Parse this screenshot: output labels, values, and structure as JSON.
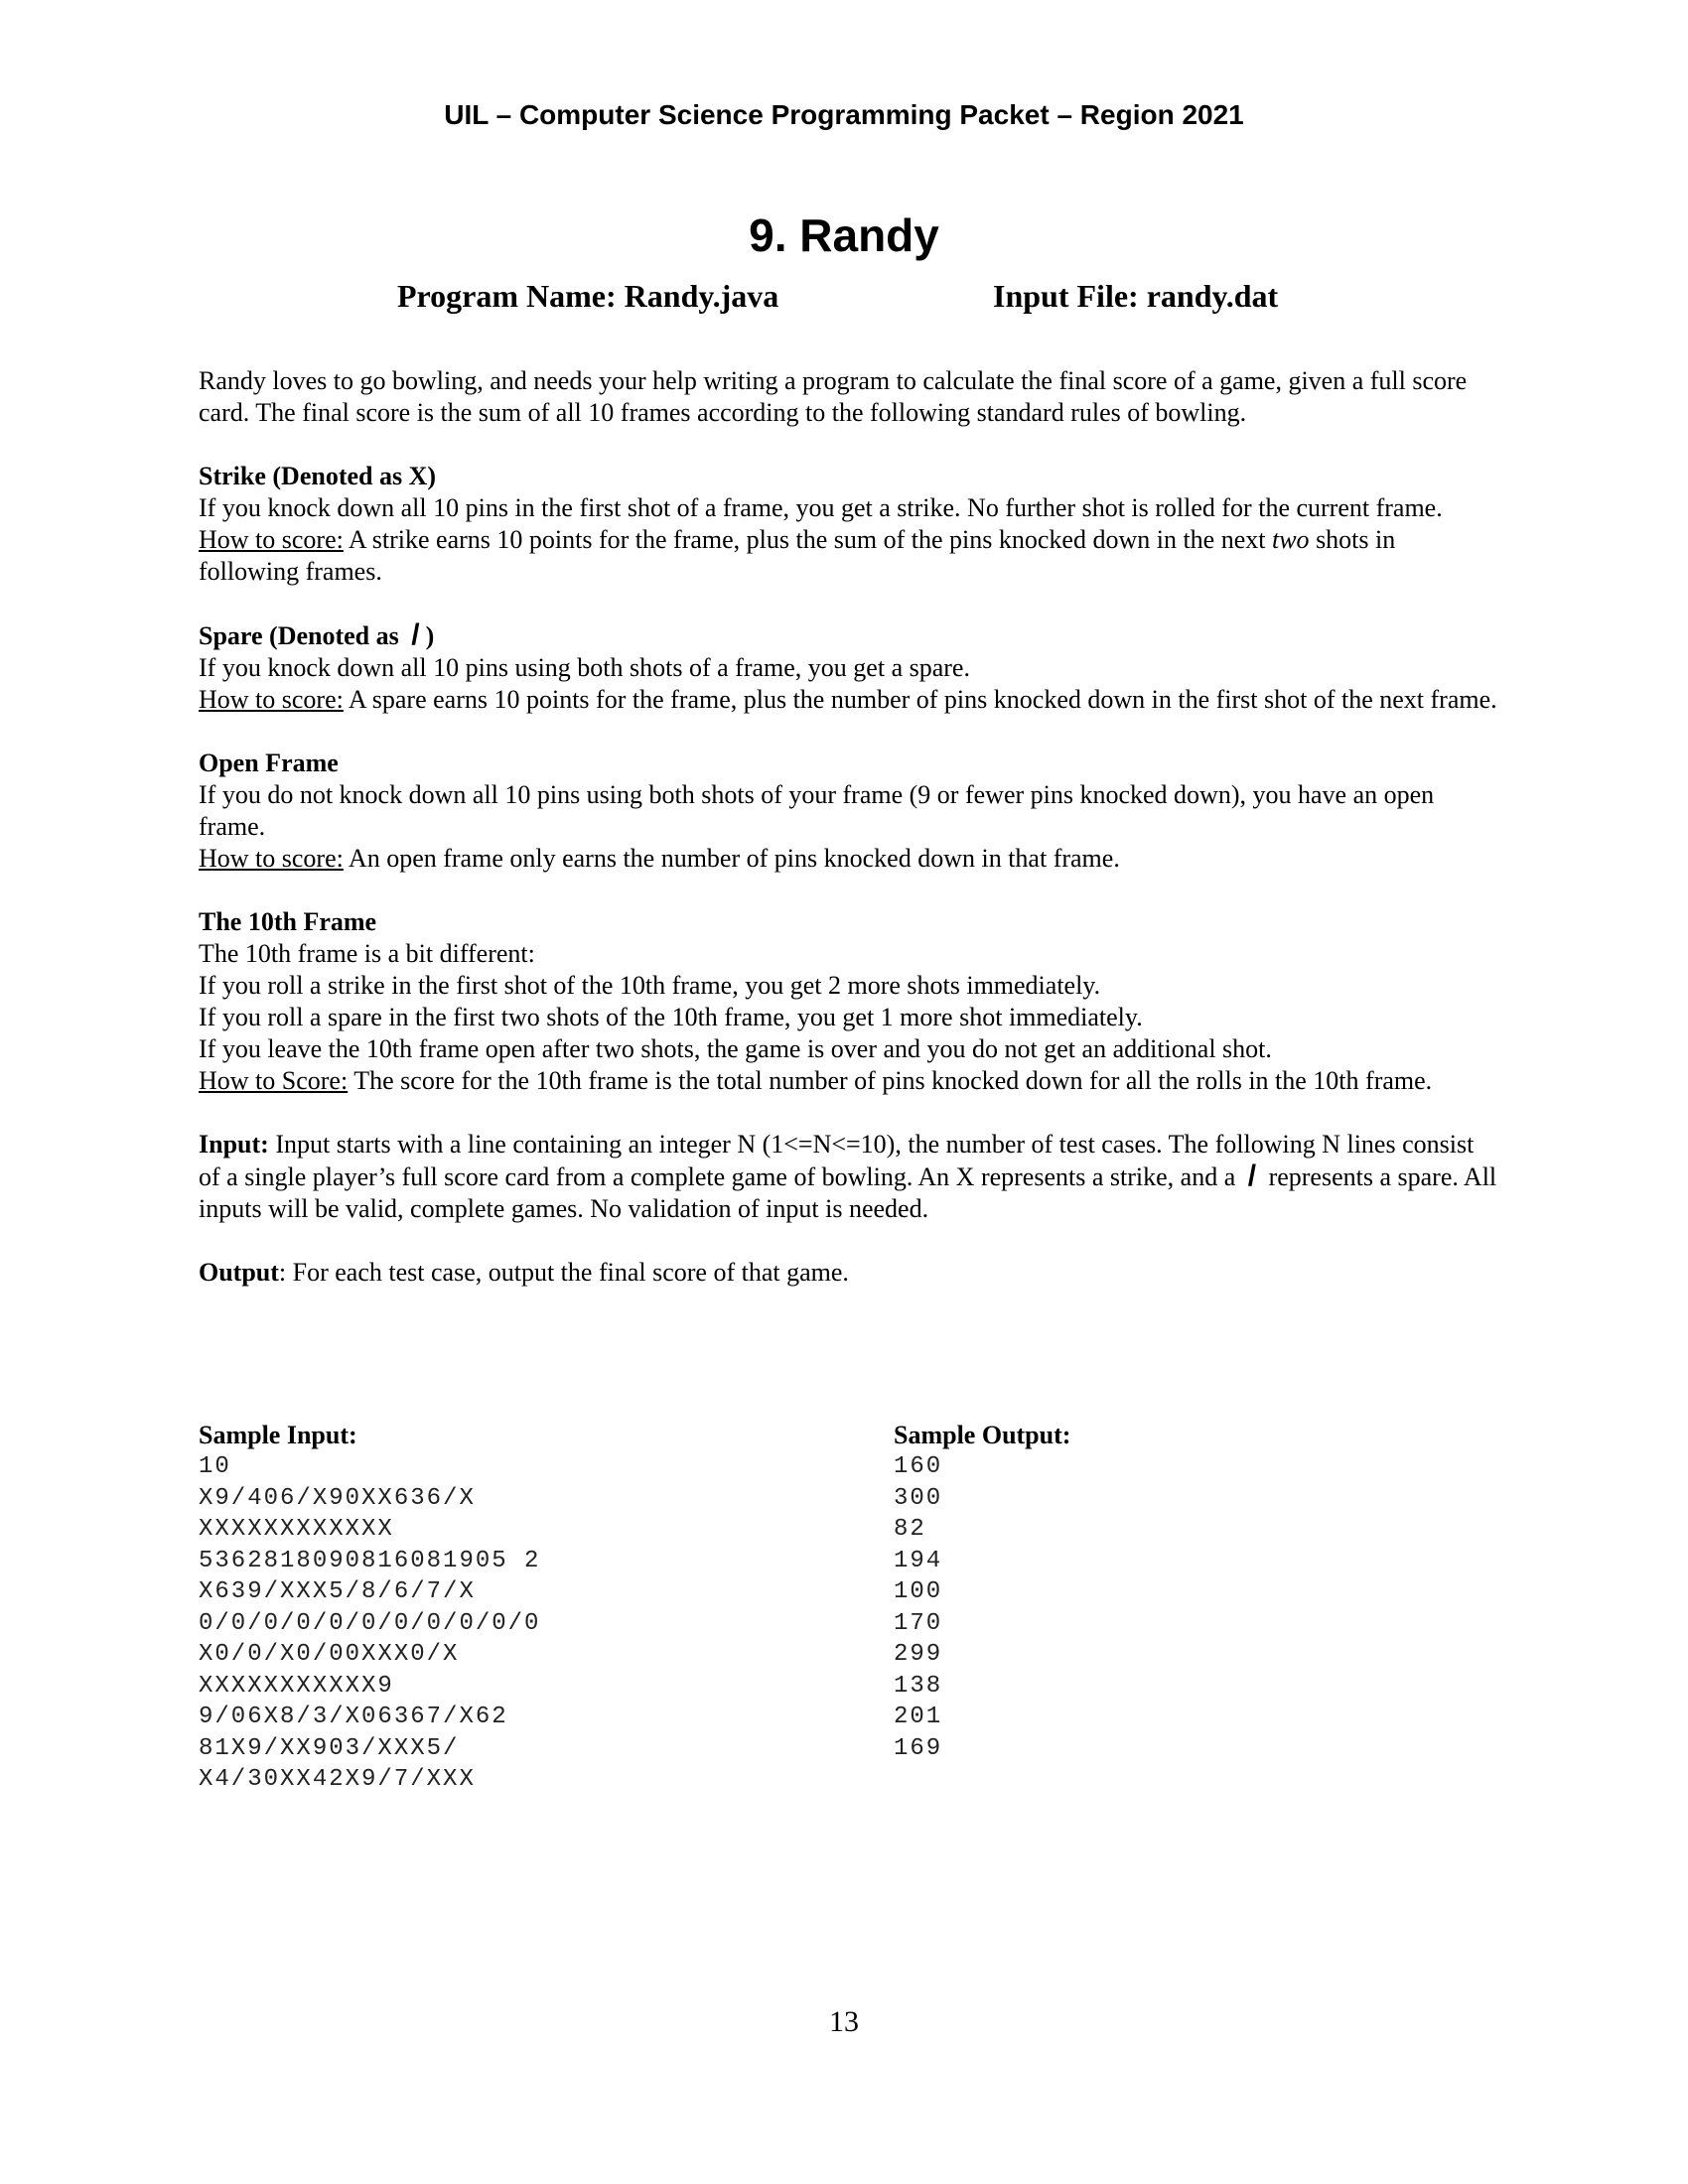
{
  "header": "UIL – Computer Science Programming Packet – Region 2021",
  "title": "9. Randy",
  "program_name": "Program Name: Randy.java",
  "input_file": "Input File: randy.dat",
  "intro": "Randy loves to go bowling, and needs your help writing a program to calculate the final score of a game, given a full score card. The final score is the sum of all 10 frames according to the following standard rules of bowling.",
  "strike": {
    "heading": "Strike (Denoted as X)",
    "text": "If you knock down all 10 pins in the first shot of a frame, you get a strike. No further shot is rolled for the current frame.",
    "how_label": "How to score:",
    "how_text_before": " A strike earns 10 points for the frame, plus the sum of the pins knocked down in the next ",
    "how_text_em": "two",
    "how_text_after": " shots in following frames."
  },
  "spare": {
    "heading_before": "Spare (Denoted as",
    "heading_symbol": "/",
    "heading_after": ")",
    "text": "If you knock down all 10 pins using both shots of a frame, you get a spare.",
    "how_label": "How to score:",
    "how_text": " A spare earns 10 points for the frame, plus the number of pins knocked down in the first shot of the next frame."
  },
  "open": {
    "heading": "Open Frame",
    "text": "If you do not knock down all 10 pins using both shots of your frame (9 or fewer pins knocked down), you have an open frame.",
    "how_label": "How to score:",
    "how_text": " An open frame only earns the number of pins knocked down in that frame."
  },
  "tenth": {
    "heading": "The 10th Frame",
    "line1": "The 10th frame is a bit different:",
    "line2": "If you roll a strike in the first shot of the 10th frame, you get 2 more shots immediately.",
    "line3": "If you roll a spare in the first two shots of the 10th frame, you get 1 more shot immediately.",
    "line4": "If you leave the 10th frame open after two shots, the game is over and you do not get an additional shot.",
    "how_label": "How to Score:",
    "how_text": " The score for the 10th frame is the total number of pins knocked down for all the rolls in the 10th frame."
  },
  "input_section": {
    "label": "Input:",
    "text_before": " Input starts with a line containing an integer N (1<=N<=10), the number of test cases. The following N lines consist of a single player’s full score card from a complete game of bowling. An X represents a strike, and a ",
    "symbol": "/",
    "text_after": " represents a spare. All inputs will be valid, complete games. No validation of input is needed."
  },
  "output_section": {
    "label": "Output",
    "text": ": For each test case, output the final score of that game."
  },
  "sample_input": {
    "label": "Sample Input:",
    "lines": [
      "10",
      "X9/406/X90XX636/X",
      "XXXXXXXXXXXX",
      "5362818090816081905 2",
      "X639/XXX5/8/6/7/X",
      "0/0/0/0/0/0/0/0/0/0/0",
      "X0/0/X0/00XXX0/X",
      "XXXXXXXXXXX9",
      "9/06X8/3/X06367/X62",
      "81X9/XX903/XXX5/",
      "X4/30XX42X9/7/XXX"
    ]
  },
  "sample_output": {
    "label": "Sample Output:",
    "lines": [
      "160",
      "300",
      "82",
      "194",
      "100",
      "170",
      "299",
      "138",
      "201",
      "169"
    ]
  },
  "page_number": "13"
}
